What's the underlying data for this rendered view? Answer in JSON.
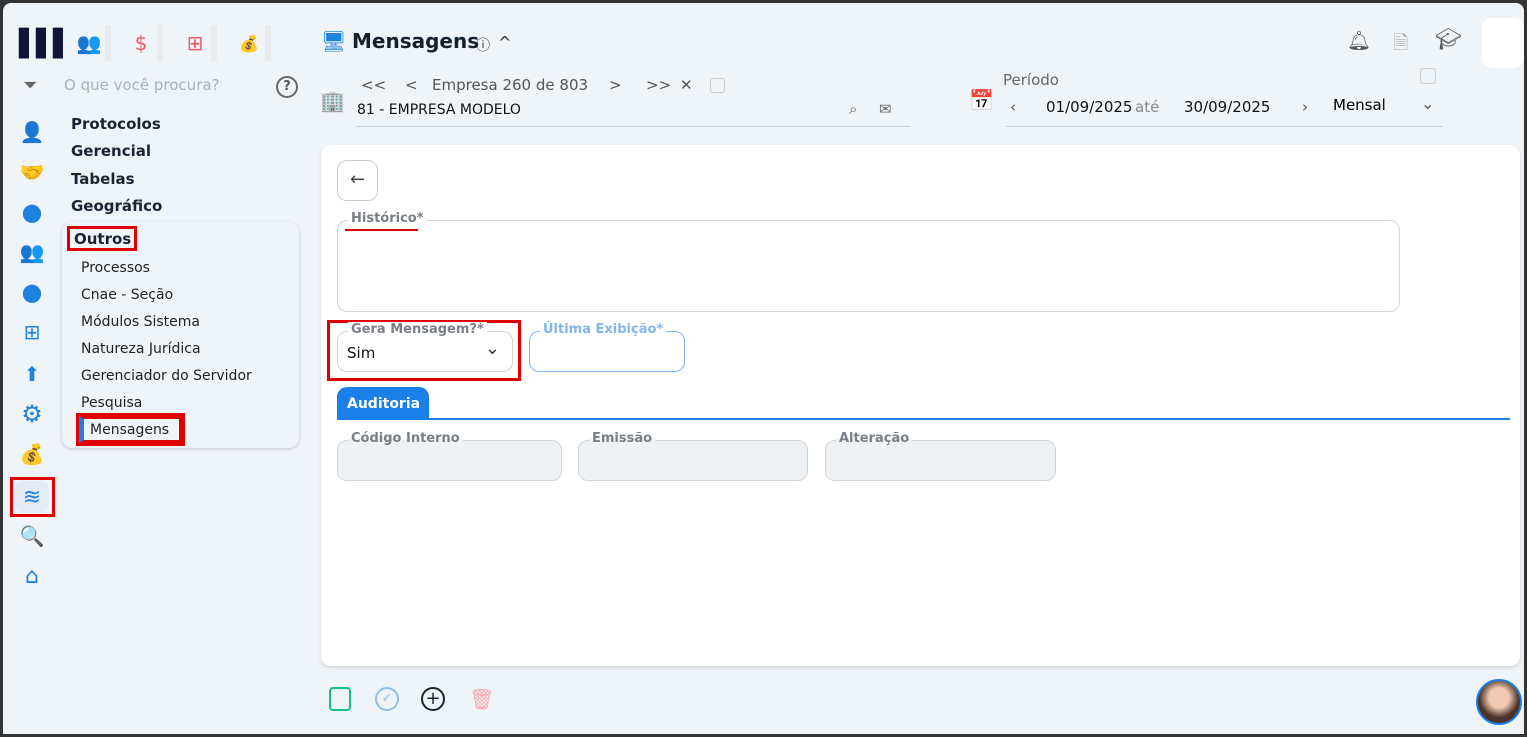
{
  "top_modules": [
    {
      "icon": "people-icon",
      "glyph": "👥"
    },
    {
      "icon": "dollar-icon",
      "glyph": "$"
    },
    {
      "icon": "calculator-icon",
      "glyph": "⊞"
    },
    {
      "icon": "money-bag-icon",
      "glyph": "💰"
    }
  ],
  "search": {
    "placeholder": "O que você procura?",
    "help": "?"
  },
  "menu": {
    "headers": [
      "Protocolos",
      "Gerencial",
      "Tabelas",
      "Geográfico"
    ],
    "group": "Outros",
    "items": [
      "Processos",
      "Cnae - Seção",
      "Módulos Sistema",
      "Natureza Jurídica",
      "Gerenciador do Servidor",
      "Pesquisa",
      "Mensagens"
    ]
  },
  "rail_icons": [
    "user-gear-icon",
    "handshake-icon",
    "clock-icon",
    "users-icon",
    "dollar-circle-icon",
    "calculator-icon",
    "arrow-percent-icon",
    "gear-plus-icon",
    "money-bag-icon",
    "layers-icon",
    "search-icon",
    "home-icon"
  ],
  "header": {
    "title": "Mensagens",
    "info": "ⓘ",
    "collapse": "^"
  },
  "company_nav": {
    "first": "<<",
    "prev": "<",
    "label": "Empresa",
    "current": "260",
    "sep": "de",
    "total": "803",
    "next": ">",
    "last": ">>",
    "clear": "✕",
    "company": "81 - EMPRESA MODELO"
  },
  "period": {
    "label": "Período",
    "start": "01/09/2025",
    "sep": "até",
    "end": "30/09/2025",
    "type": "Mensal"
  },
  "form": {
    "historico_label": "Histórico*",
    "historico_value": "",
    "gera_label": "Gera Mensagem?*",
    "gera_value": "Sim",
    "ultima_label": "Última Exibição*",
    "ultima_value": "",
    "tab": "Auditoria",
    "codigo_label": "Código Interno",
    "emissao_label": "Emissão",
    "alteracao_label": "Alteração"
  },
  "colors": {
    "accent": "#1a7fe8",
    "red": "#e00000",
    "bg": "#eff4f9"
  }
}
